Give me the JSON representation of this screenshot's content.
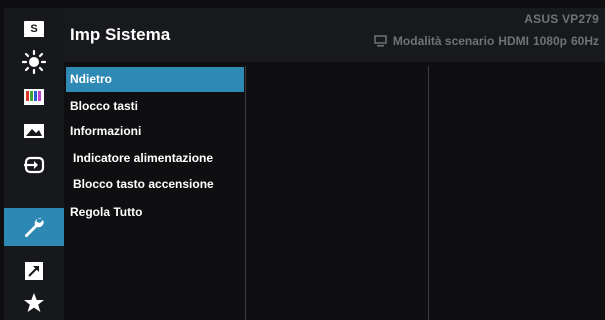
{
  "header": {
    "title": "Imp Sistema",
    "model": "ASUS  VP279",
    "status": {
      "icon": "monitor-icon",
      "mode": "Modalità scenario",
      "input": "HDMI",
      "resolution": "1080p",
      "refresh": "60Hz"
    }
  },
  "sidebar": {
    "items": [
      {
        "name": "splendid",
        "icon": "s-icon"
      },
      {
        "name": "blue-light-filter",
        "icon": "light-icon"
      },
      {
        "name": "color",
        "icon": "color-bars-icon"
      },
      {
        "name": "image",
        "icon": "image-icon"
      },
      {
        "name": "input-select",
        "icon": "input-icon"
      },
      {
        "name": "system-setup",
        "icon": "wrench-icon",
        "active": true
      },
      {
        "name": "shortcut",
        "icon": "arrow-icon"
      },
      {
        "name": "favorite",
        "icon": "star-icon"
      }
    ]
  },
  "menu": {
    "items": [
      {
        "label": "Ndietro",
        "selected": true
      },
      {
        "label": "Blocco tasti"
      },
      {
        "label": "Informazioni"
      },
      {
        "label": "Indicatore alimentazione"
      },
      {
        "label": "Blocco tasto accensione"
      },
      {
        "label": "Regola Tutto"
      }
    ]
  },
  "colors": {
    "accent": "#2e88b4",
    "background": "#0f0f11",
    "header": "#17191c",
    "text": "#ffffff",
    "muted": "#6f7276"
  }
}
